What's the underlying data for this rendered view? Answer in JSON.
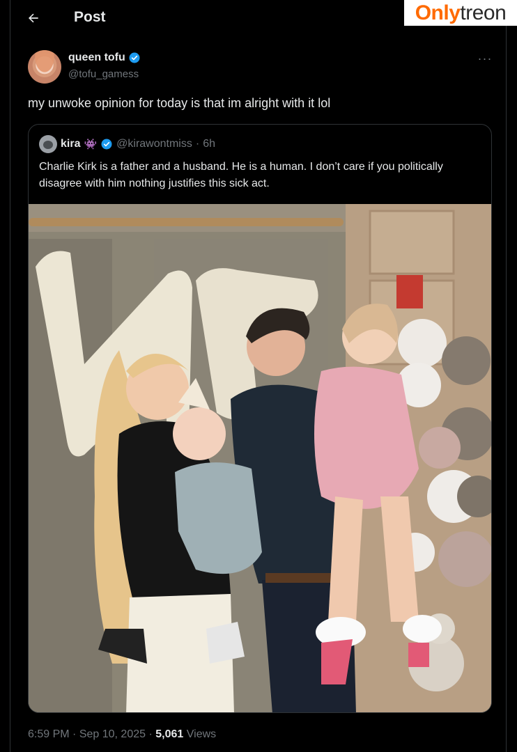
{
  "header": {
    "title": "Post"
  },
  "watermark": {
    "part1": "Only",
    "part2": "treon"
  },
  "post": {
    "author_name": "queen tofu",
    "author_handle": "@tofu_gamess",
    "more": "···",
    "text": "my unwoke opinion for today is that im alright with it lol",
    "time": "6:59 PM",
    "date": "Sep 10, 2025",
    "views_count": "5,061",
    "views_label": "Views"
  },
  "quote": {
    "name": "kira",
    "emoji": "👾",
    "handle": "@kirawontmiss",
    "separator": "·",
    "time": "6h",
    "text": "Charlie Kirk is a father and a husband. He is a human. I don’t care if you politically disagree with him nothing justifies this sick act."
  },
  "colors": {
    "background": "#000000",
    "text": "#e7e9ea",
    "muted": "#71767b",
    "border": "#2f3336",
    "verified": "#1d9bf0",
    "watermark_accent": "#ff6a00"
  },
  "icons": {
    "back": "back-arrow-icon",
    "verified": "verified-badge-icon",
    "more": "more-options-icon"
  }
}
